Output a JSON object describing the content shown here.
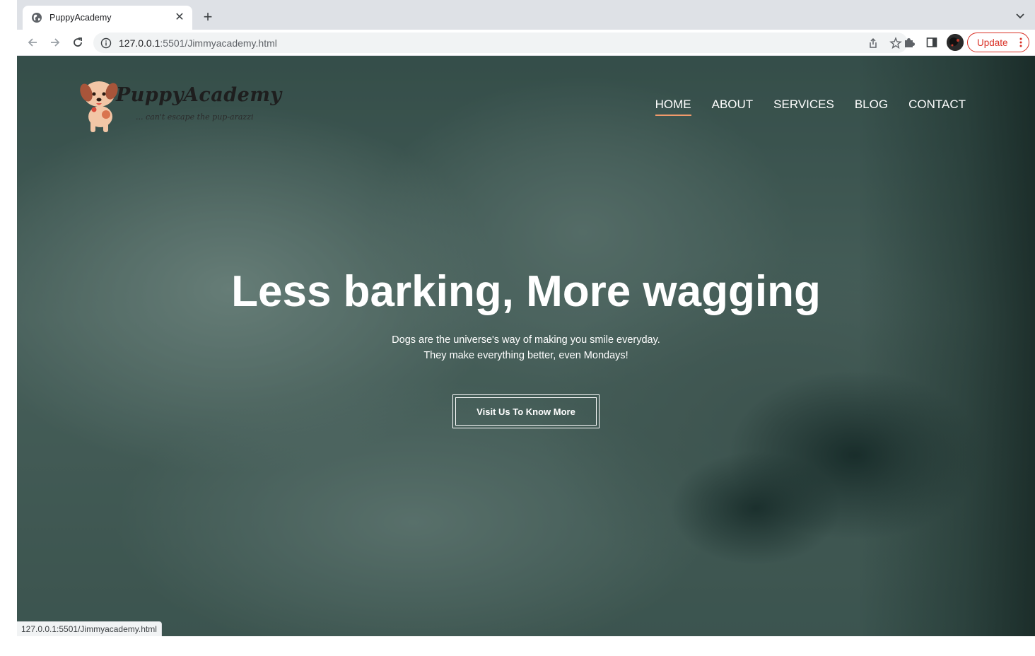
{
  "browser": {
    "tab_title": "PuppyAcademy",
    "url_host": "127.0.0.1",
    "url_rest": ":5501/Jimmyacademy.html",
    "update_label": "Update",
    "status_url": "127.0.0.1:5501/Jimmyacademy.html",
    "accent_color": "#d93025"
  },
  "site": {
    "logo_name": "PuppyAcademy",
    "logo_tagline": "... can't escape the pup-arazzi",
    "nav": [
      {
        "label": "HOME",
        "active": true
      },
      {
        "label": "ABOUT",
        "active": false
      },
      {
        "label": "SERVICES",
        "active": false
      },
      {
        "label": "BLOG",
        "active": false
      },
      {
        "label": "CONTACT",
        "active": false
      }
    ],
    "nav_active_color": "#f29a6b",
    "hero": {
      "title": "Less barking, More wagging",
      "subtitle_line1": "Dogs are the universe's way of making you smile everyday.",
      "subtitle_line2": "They make everything better, even Mondays!",
      "cta_label": "Visit Us To Know More"
    }
  }
}
